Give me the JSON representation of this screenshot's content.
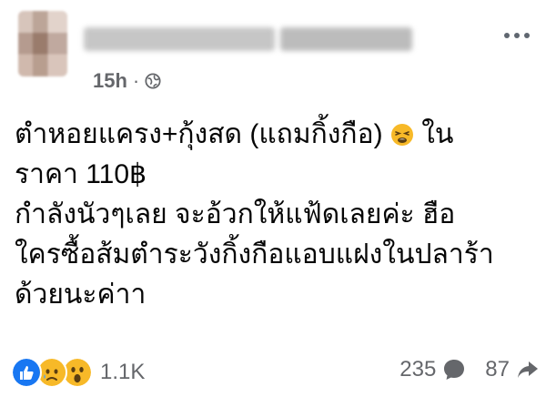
{
  "post": {
    "author_name": "",
    "timestamp": "15h",
    "separator": "·",
    "audience_icon": "globe-icon",
    "text_lines": [
      "ตำหอยแครง+กุ้งสด (แถมกิ้งกือ)",
      "ราคา 110฿",
      "กำลังนัวๆเลย จะอ้วกให้แฟ้ดเลยค่ะ ฮือ",
      "ใครซื้อส้มตำระวังกิ้งกือแอบแฝงในปลาร้า",
      "ด้วยนะค่าา"
    ],
    "line1_suffix": "ใน",
    "emoji": "tired-face-emoji"
  },
  "footer": {
    "reaction_icons": [
      "like-icon",
      "sad-icon",
      "wow-icon"
    ],
    "reaction_count": "1.1K",
    "comment_count": "235",
    "comment_icon": "comment-icon",
    "share_count": "87",
    "share_icon": "share-icon"
  },
  "colors": {
    "text": "#050505",
    "muted": "#65676b",
    "like_blue": "#1877f2",
    "emoji_yellow": "#f7b928"
  }
}
